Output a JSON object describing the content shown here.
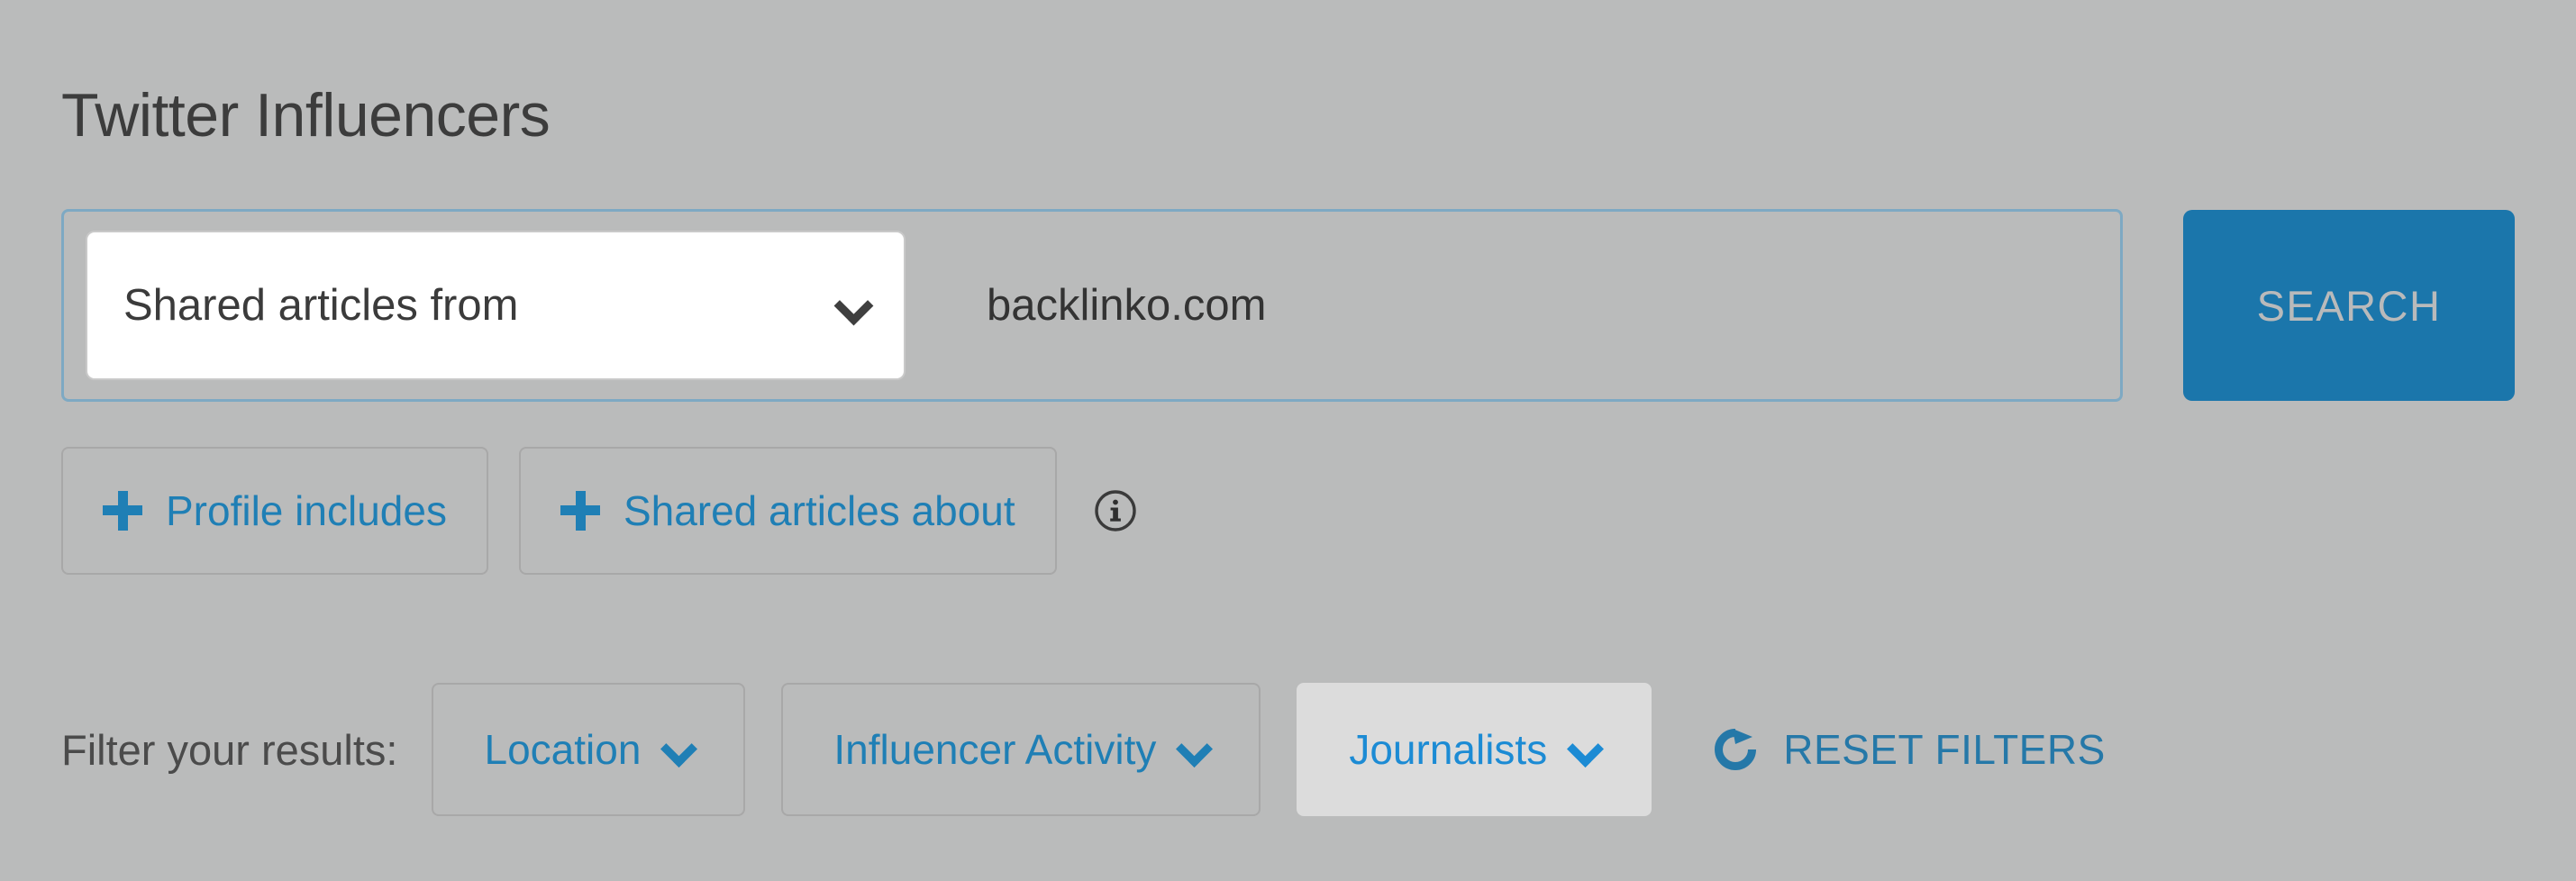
{
  "page": {
    "title": "Twitter Influencers",
    "background_color": "#babbbb",
    "accent_color": "#1f7fb5",
    "accent_color_active": "#1c8bd4",
    "search_button_color": "#1b76ab"
  },
  "search": {
    "select_label": "Shared articles from",
    "select_icon": "chevron-down-icon",
    "query_value": "backlinko.com",
    "query_placeholder": "backlinko.com",
    "submit_label": "SEARCH"
  },
  "add_filters": {
    "chips": [
      {
        "label": "Profile includes",
        "icon": "plus-icon"
      },
      {
        "label": "Shared articles about",
        "icon": "plus-icon"
      }
    ],
    "info_icon": "info-circle-icon"
  },
  "result_filters": {
    "label": "Filter your results:",
    "buttons": [
      {
        "label": "Location",
        "icon": "chevron-down-icon",
        "active": false
      },
      {
        "label": "Influencer Activity",
        "icon": "chevron-down-icon",
        "active": false
      },
      {
        "label": "Journalists",
        "icon": "chevron-down-icon",
        "active": true
      }
    ],
    "reset": {
      "label": "RESET FILTERS",
      "icon": "refresh-icon"
    }
  }
}
